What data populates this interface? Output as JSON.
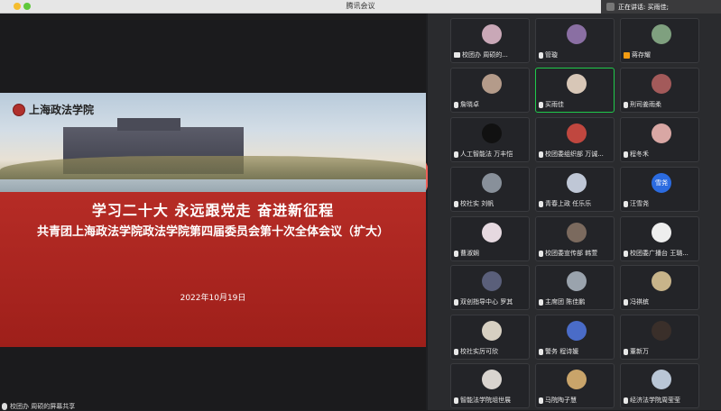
{
  "window": {
    "title": "腾讯会议"
  },
  "speaking": {
    "text": "正在讲话: 买雨佳;"
  },
  "slide": {
    "logo_text": "上海政法学院",
    "headline": "学习二十大 永远跟党走 奋进新征程",
    "subheadline": "共青团上海政法学院政法学院第四届委员会第十次全体会议（扩大）",
    "date": "2022年10月19日"
  },
  "share_label": "校团办 周硕的屏幕共享",
  "participants": [
    {
      "name": "校团办 周硕的...",
      "avatar": "#c9a8b7",
      "icon": "screen",
      "active": false
    },
    {
      "name": "管璇",
      "avatar": "#8a6fa3",
      "icon": "mic",
      "active": false
    },
    {
      "name": "蒋存耀",
      "avatar": "#7fa07f",
      "icon": "host",
      "active": false
    },
    {
      "name": "詹晓卓",
      "avatar": "#b49b8a",
      "icon": "mic",
      "active": false
    },
    {
      "name": "买雨佳",
      "avatar": "#d8c7b7",
      "icon": "mic",
      "active": true
    },
    {
      "name": "刑司姜雨柔",
      "avatar": "#a35a5a",
      "icon": "mic",
      "active": false
    },
    {
      "name": "人工智能法 万丰恺",
      "avatar": "#111111",
      "icon": "mic",
      "active": false
    },
    {
      "name": "校团委组织部 万诚...",
      "avatar": "#c0473f",
      "icon": "mic",
      "active": false
    },
    {
      "name": "程冬禾",
      "avatar": "#d9a7a4",
      "icon": "mic",
      "active": false
    },
    {
      "name": "校社实 刘帆",
      "avatar": "#88909a",
      "icon": "mic",
      "active": false
    },
    {
      "name": "青春上政 任乐乐",
      "avatar": "#bfc7d6",
      "icon": "mic",
      "active": false
    },
    {
      "name": "汪雪尧",
      "avatar": "#2b6be0",
      "avatar_text": "雪尧",
      "icon": "mic",
      "active": false
    },
    {
      "name": "曹淑娴",
      "avatar": "#e6d9e0",
      "icon": "mic",
      "active": false
    },
    {
      "name": "校团委宣传部 韩萱",
      "avatar": "#7b6a5e",
      "icon": "mic",
      "active": false
    },
    {
      "name": "校团委广播台 王璐...",
      "avatar": "#eeeeee",
      "icon": "mic",
      "active": false
    },
    {
      "name": "双创指导中心 罗其",
      "avatar": "#5a5f7a",
      "icon": "mic",
      "active": false
    },
    {
      "name": "主席团 陈佳鹏",
      "avatar": "#9aa3ad",
      "icon": "mic",
      "active": false
    },
    {
      "name": "冯祺槟",
      "avatar": "#c8b48a",
      "icon": "mic",
      "active": false
    },
    {
      "name": "校社实厉可欣",
      "avatar": "#d7d0c2",
      "icon": "mic",
      "active": false
    },
    {
      "name": "警务 程诗媛",
      "avatar": "#4a6cc8",
      "icon": "mic",
      "active": false
    },
    {
      "name": "董新万",
      "avatar": "#3a2f2a",
      "icon": "mic",
      "active": false
    },
    {
      "name": "智能法学院俎世展",
      "avatar": "#d9d4cf",
      "icon": "mic",
      "active": false
    },
    {
      "name": "马院陶子慧",
      "avatar": "#c9a46a",
      "icon": "mic",
      "active": false
    },
    {
      "name": "经济法学院周莹莹",
      "avatar": "#b9c6d6",
      "icon": "mic",
      "active": false
    }
  ]
}
